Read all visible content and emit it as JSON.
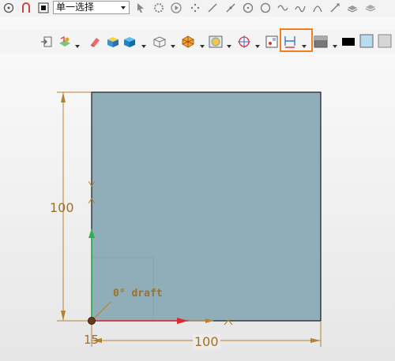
{
  "toolbar": {
    "selection_filter": "单一选择"
  },
  "dimensions": {
    "height_value": "100",
    "width_value": "100",
    "small_value": "15",
    "draft_label": "0° draft"
  }
}
